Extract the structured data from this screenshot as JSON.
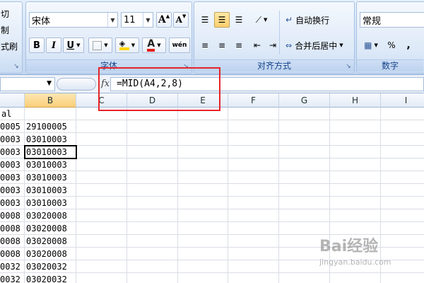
{
  "ribbon": {
    "clipboard": {
      "cut_label": "切",
      "copy_label": "制",
      "format_painter_label": "式刷"
    },
    "font": {
      "group_label": "字体",
      "font_name": "宋体",
      "font_size": "11",
      "grow_label": "A",
      "shrink_label": "A",
      "bold_label": "B",
      "italic_label": "I",
      "underline_label": "U",
      "font_color_label": "A",
      "phonetic_label": "wén"
    },
    "alignment": {
      "group_label": "对齐方式",
      "wrap_text_label": "自动换行",
      "merge_center_label": "合并后居中"
    },
    "number": {
      "group_label": "数字",
      "format_value": "常规",
      "percent_label": "%",
      "comma_label": ","
    }
  },
  "formula_bar": {
    "name_box": "",
    "fx_label": "fx",
    "formula": "=MID(A4,2,8)"
  },
  "grid": {
    "columns": [
      "B",
      "C",
      "D",
      "E",
      "F",
      "G",
      "H",
      "I"
    ],
    "selected_column": "B",
    "col_a_header_partial": "al",
    "col_a": [
      "0005",
      "0003",
      "0003",
      "0003",
      "0003",
      "0003",
      "0003",
      "0008",
      "0008",
      "0008",
      "0008",
      "0032",
      "0032"
    ],
    "col_b": [
      "29100005",
      "03010003",
      "03010003",
      "03010003",
      "03010003",
      "03010003",
      "03010003",
      "03020008",
      "03020008",
      "03020008",
      "03020008",
      "03020032",
      "03020032"
    ],
    "active_row_index": 2
  },
  "watermark": {
    "text": "Bai经验",
    "sub": "jingyan.baidu.com"
  },
  "colors": {
    "highlight": "#e8232a",
    "selected_header": "#f9cf78",
    "ribbon_text": "#15428b"
  }
}
